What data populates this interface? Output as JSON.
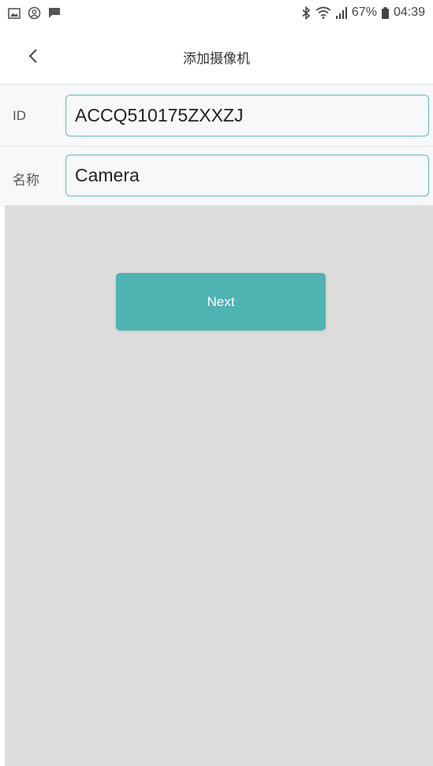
{
  "status_bar": {
    "left_icons": [
      "gallery-icon",
      "vpn-icon",
      "message-icon"
    ],
    "right_icons": [
      "bluetooth-icon",
      "wifi-icon",
      "signal-icon",
      "battery-icon"
    ],
    "battery": "67%",
    "time": "04:39"
  },
  "header": {
    "title": "添加摄像机",
    "back_icon": "chevron-left-icon"
  },
  "form": {
    "id_label": "ID",
    "id_value": "ACCQ510175ZXXZJ",
    "name_label": "名称",
    "name_value": "Camera"
  },
  "actions": {
    "next_label": "Next"
  },
  "colors": {
    "accent": "#4fb3b2",
    "input_border": "#5cbcb8",
    "content_background": "#dcdcdc"
  }
}
